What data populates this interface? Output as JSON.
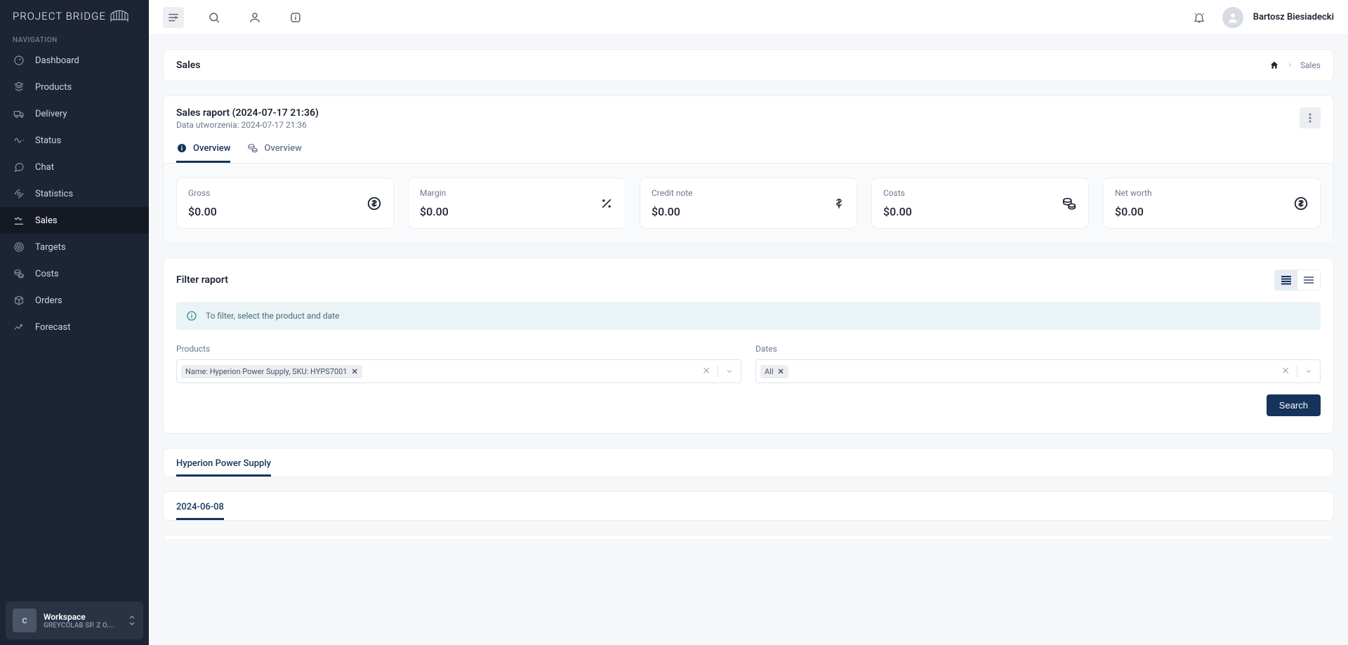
{
  "brand": "PROJECT BRIDGE",
  "sidebar": {
    "section_label": "NAVIGATION",
    "items": [
      {
        "icon": "dashboard",
        "label": "Dashboard"
      },
      {
        "icon": "products",
        "label": "Products"
      },
      {
        "icon": "delivery",
        "label": "Delivery"
      },
      {
        "icon": "status",
        "label": "Status"
      },
      {
        "icon": "chat",
        "label": "Chat"
      },
      {
        "icon": "statistics",
        "label": "Statistics"
      },
      {
        "icon": "sales",
        "label": "Sales"
      },
      {
        "icon": "targets",
        "label": "Targets"
      },
      {
        "icon": "costs",
        "label": "Costs"
      },
      {
        "icon": "orders",
        "label": "Orders"
      },
      {
        "icon": "forecast",
        "label": "Forecast"
      }
    ],
    "active_index": 6,
    "workspace": {
      "avatar_letter": "c",
      "title": "Workspace",
      "subtitle": "GREYCOLAB SP. Z O...."
    }
  },
  "topbar": {
    "user_name": "Bartosz Biesiadecki"
  },
  "page": {
    "title": "Sales",
    "breadcrumb_current": "Sales"
  },
  "report": {
    "title": "Sales raport (2024-07-17 21:36)",
    "subtitle": "Data utworzenia: 2024-07-17 21:36",
    "tabs": [
      {
        "label": "Overview",
        "icon": "info",
        "active": true
      },
      {
        "label": "Overview",
        "icon": "costs",
        "active": false
      }
    ],
    "stats": [
      {
        "label": "Gross",
        "value": "$0.00",
        "icon": "dollar-circle"
      },
      {
        "label": "Margin",
        "value": "$0.00",
        "icon": "percent"
      },
      {
        "label": "Credit note",
        "value": "$0.00",
        "icon": "dollar"
      },
      {
        "label": "Costs",
        "value": "$0.00",
        "icon": "coins"
      },
      {
        "label": "Net worth",
        "value": "$0.00",
        "icon": "dollar-circle"
      }
    ]
  },
  "filter": {
    "title": "Filter raport",
    "hint": "To filter, select the product and date",
    "products_label": "Products",
    "dates_label": "Dates",
    "product_chip": "Name: Hyperion Power Supply, SKU: HYPS7001",
    "date_chip": "All",
    "search_label": "Search"
  },
  "product_tab": {
    "label": "Hyperion Power Supply"
  },
  "date_tab": {
    "label": "2024-06-08"
  }
}
